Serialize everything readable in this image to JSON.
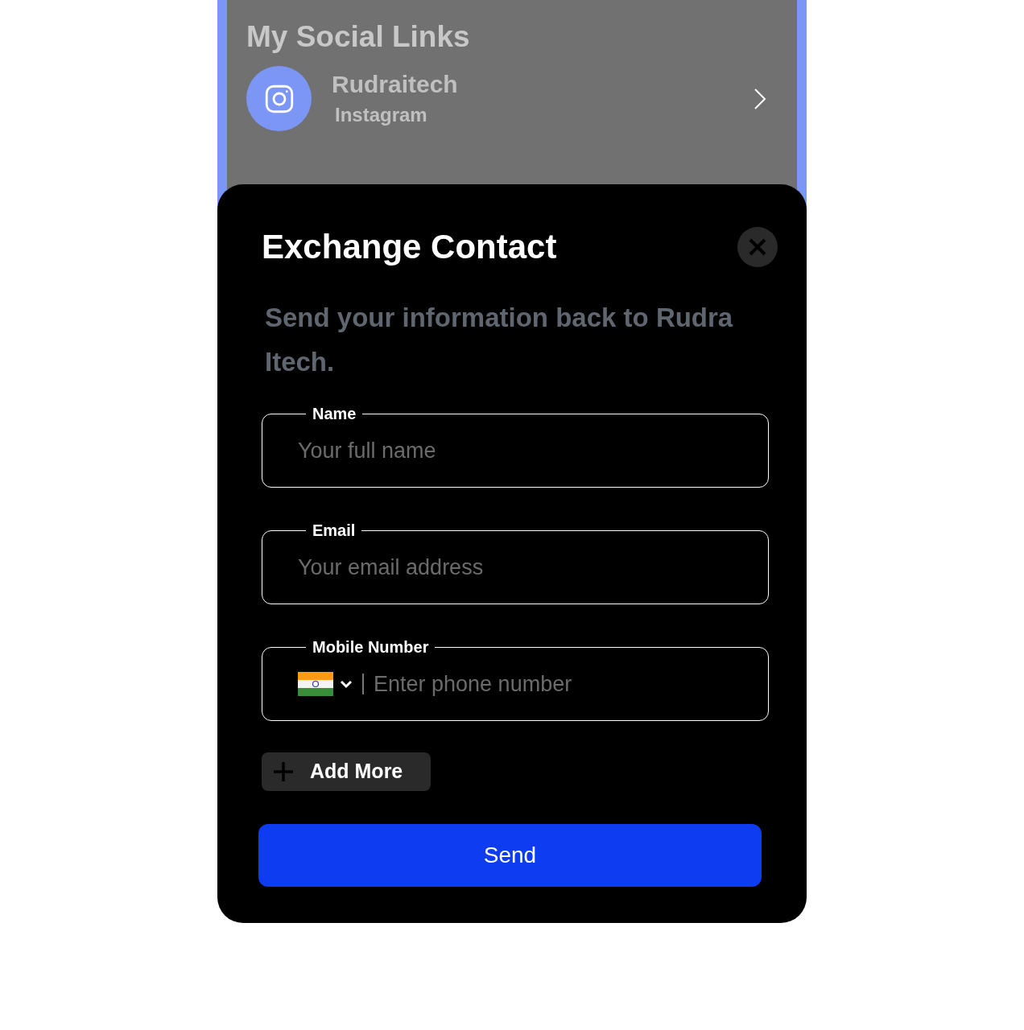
{
  "background": {
    "heading": "My Social Links",
    "links": [
      {
        "title": "Rudraitech",
        "platform": "Instagram"
      }
    ]
  },
  "dialog": {
    "title": "Exchange Contact",
    "message": "Send your information back to Rudra Itech.",
    "fields": [
      {
        "kind": "text",
        "label": "Name",
        "placeholder": "Your full name"
      },
      {
        "kind": "text",
        "label": "Email",
        "placeholder": "Your email address"
      },
      {
        "kind": "phone",
        "label": "Mobile Number",
        "placeholder": "Enter phone number"
      }
    ],
    "add_button": "Add More",
    "submit_button": "Send"
  }
}
